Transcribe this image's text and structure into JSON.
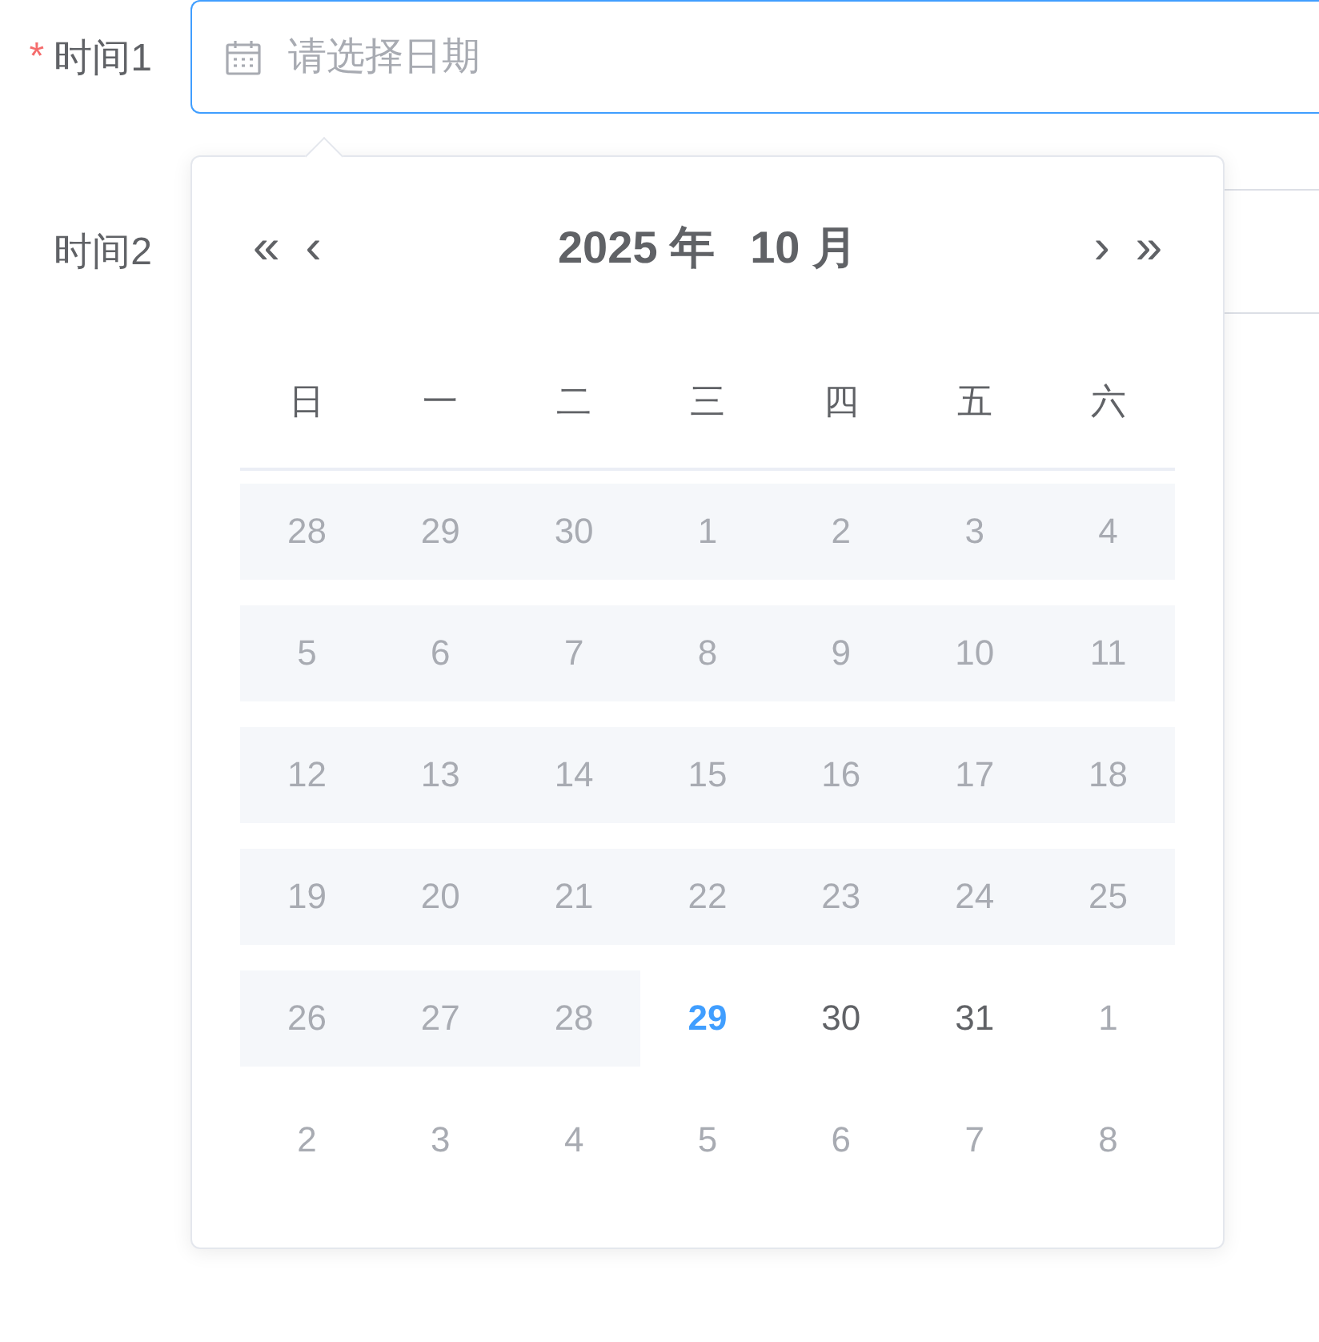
{
  "fields": [
    {
      "label": "时间1",
      "required_mark": "*",
      "focused": true,
      "placeholder": "请选择日期"
    },
    {
      "label": "时间2",
      "focused": false
    }
  ],
  "picker": {
    "prev_year": "«",
    "prev_month": "‹",
    "year": "2025",
    "year_unit": "年",
    "month": "10",
    "month_unit": "月",
    "next_month": "›",
    "next_year": "»",
    "weekdays": [
      "日",
      "一",
      "二",
      "三",
      "四",
      "五",
      "六"
    ],
    "weeks": [
      [
        {
          "day": "28",
          "kind": "disabled"
        },
        {
          "day": "29",
          "kind": "disabled"
        },
        {
          "day": "30",
          "kind": "disabled"
        },
        {
          "day": "1",
          "kind": "disabled"
        },
        {
          "day": "2",
          "kind": "disabled"
        },
        {
          "day": "3",
          "kind": "disabled"
        },
        {
          "day": "4",
          "kind": "disabled"
        }
      ],
      [
        {
          "day": "5",
          "kind": "disabled"
        },
        {
          "day": "6",
          "kind": "disabled"
        },
        {
          "day": "7",
          "kind": "disabled"
        },
        {
          "day": "8",
          "kind": "disabled"
        },
        {
          "day": "9",
          "kind": "disabled"
        },
        {
          "day": "10",
          "kind": "disabled"
        },
        {
          "day": "11",
          "kind": "disabled"
        }
      ],
      [
        {
          "day": "12",
          "kind": "disabled"
        },
        {
          "day": "13",
          "kind": "disabled"
        },
        {
          "day": "14",
          "kind": "disabled"
        },
        {
          "day": "15",
          "kind": "disabled"
        },
        {
          "day": "16",
          "kind": "disabled"
        },
        {
          "day": "17",
          "kind": "disabled"
        },
        {
          "day": "18",
          "kind": "disabled"
        }
      ],
      [
        {
          "day": "19",
          "kind": "disabled"
        },
        {
          "day": "20",
          "kind": "disabled"
        },
        {
          "day": "21",
          "kind": "disabled"
        },
        {
          "day": "22",
          "kind": "disabled"
        },
        {
          "day": "23",
          "kind": "disabled"
        },
        {
          "day": "24",
          "kind": "disabled"
        },
        {
          "day": "25",
          "kind": "disabled"
        }
      ],
      [
        {
          "day": "26",
          "kind": "disabled"
        },
        {
          "day": "27",
          "kind": "disabled"
        },
        {
          "day": "28",
          "kind": "disabled"
        },
        {
          "day": "29",
          "kind": "today"
        },
        {
          "day": "30",
          "kind": "current"
        },
        {
          "day": "31",
          "kind": "current"
        },
        {
          "day": "1",
          "kind": "other"
        }
      ],
      [
        {
          "day": "2",
          "kind": "other"
        },
        {
          "day": "3",
          "kind": "other"
        },
        {
          "day": "4",
          "kind": "other"
        },
        {
          "day": "5",
          "kind": "other"
        },
        {
          "day": "6",
          "kind": "other"
        },
        {
          "day": "7",
          "kind": "other"
        },
        {
          "day": "8",
          "kind": "other"
        }
      ]
    ]
  }
}
